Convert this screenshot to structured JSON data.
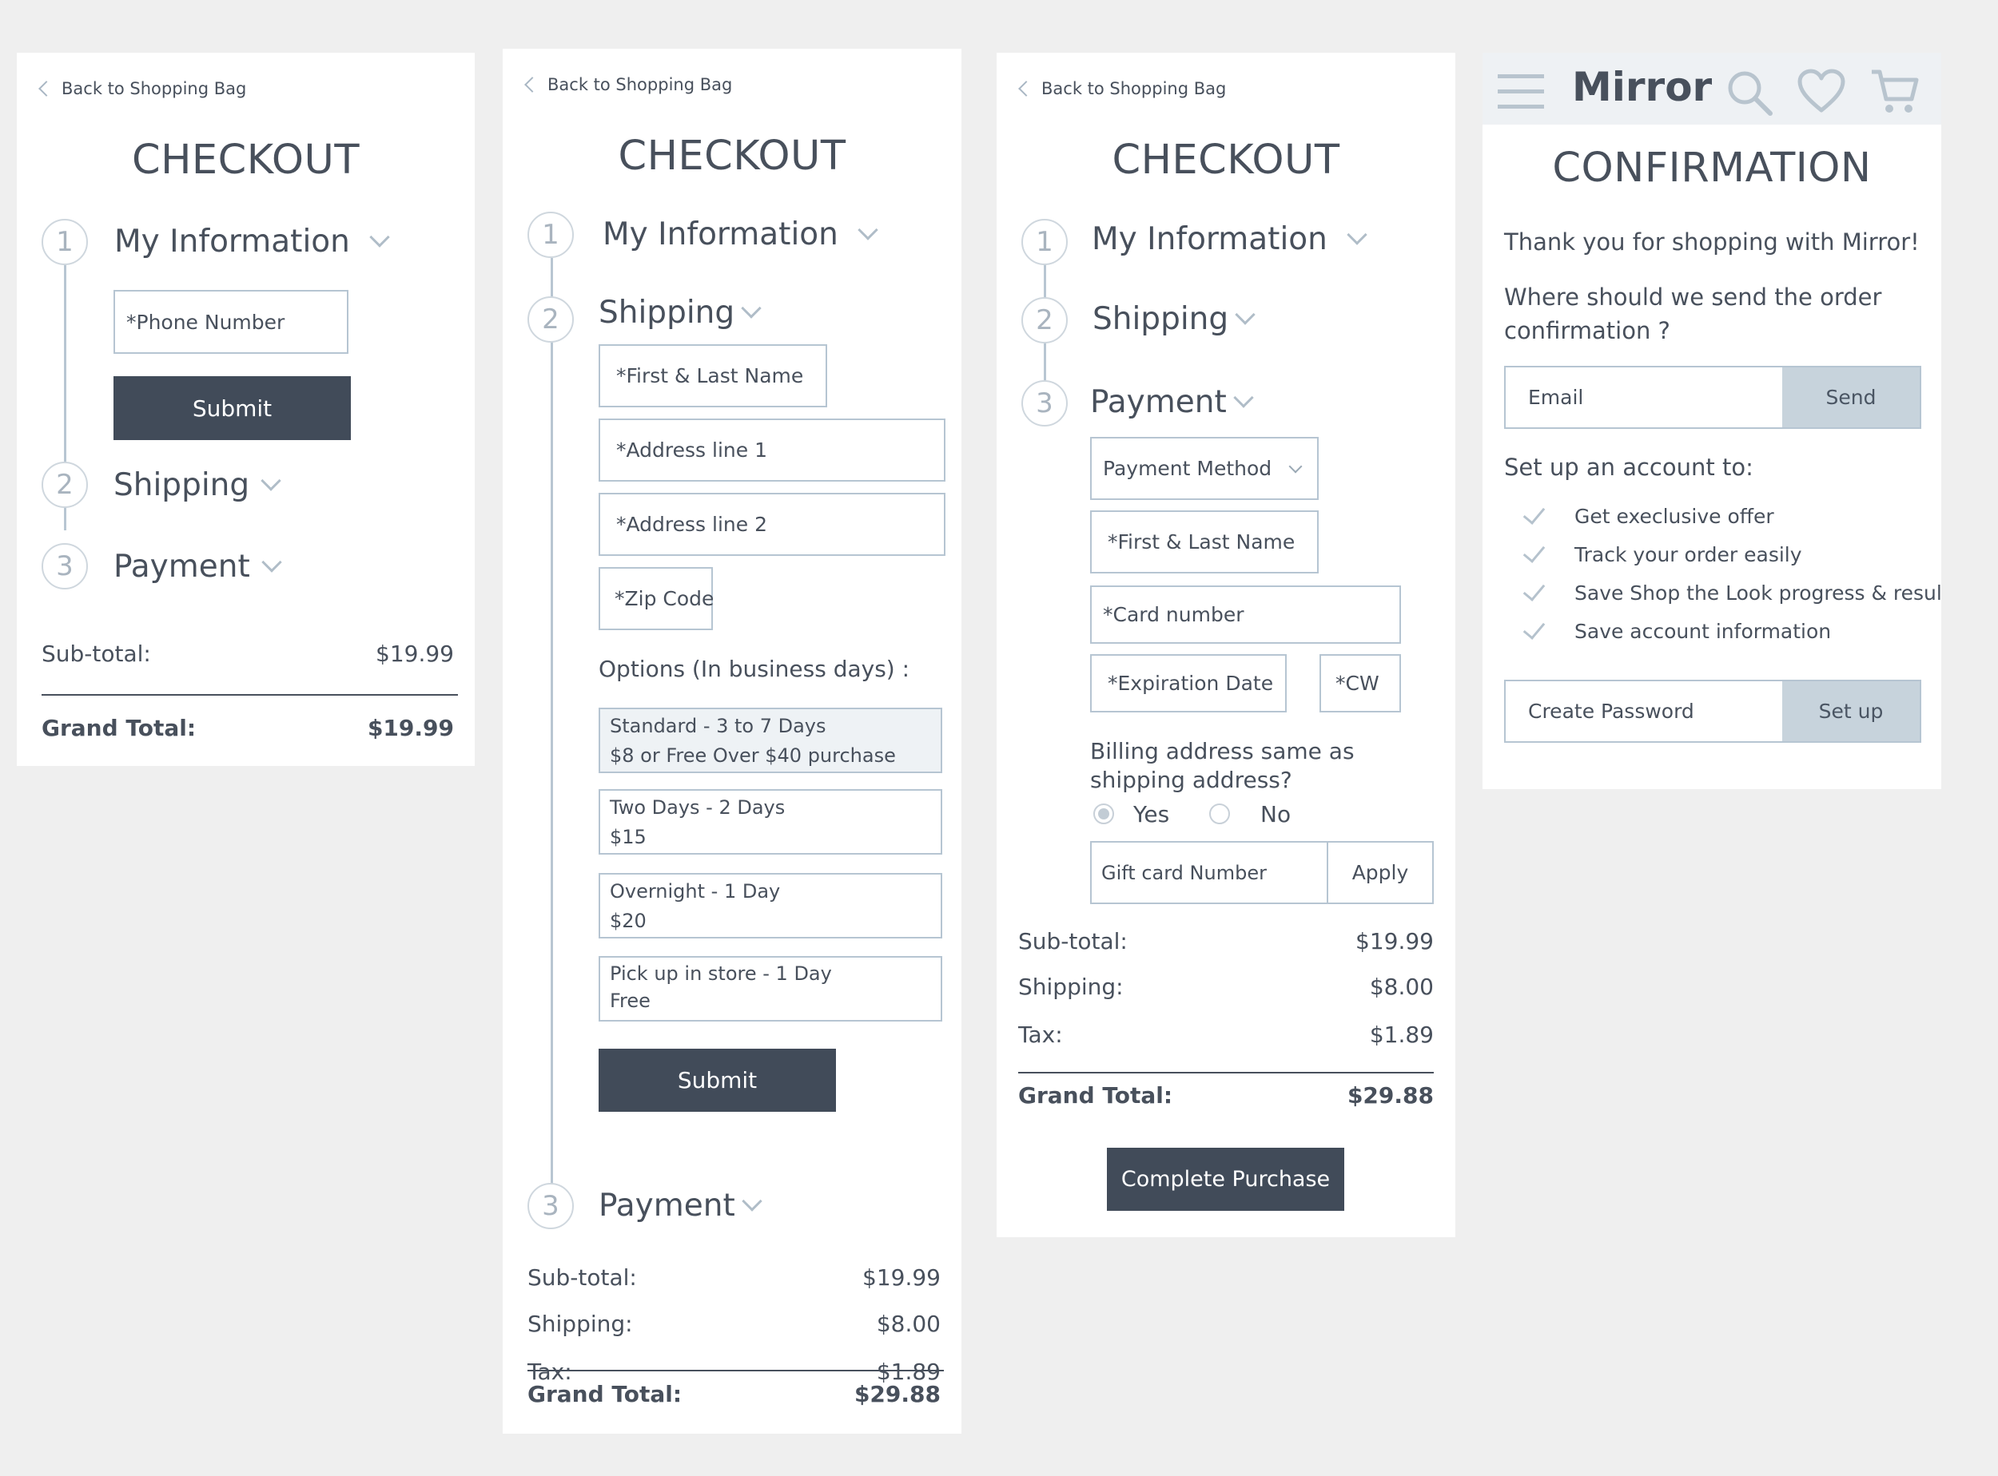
{
  "colors": {
    "accent_dark": "#414b59",
    "accent_light": "#c7d3dc",
    "border": "#b6c5d2",
    "background": "#efefef"
  },
  "panel1": {
    "back_label": "Back to Shopping Bag",
    "title": "CHECKOUT",
    "steps": [
      {
        "number": "1",
        "label": "My Information"
      },
      {
        "number": "2",
        "label": "Shipping"
      },
      {
        "number": "3",
        "label": "Payment"
      }
    ],
    "phone_placeholder": "*Phone Number",
    "submit_label": "Submit",
    "subtotal_label": "Sub-total:",
    "subtotal_value": "$19.99",
    "grand_label": "Grand Total:",
    "grand_value": "$19.99"
  },
  "panel2": {
    "back_label": "Back to Shopping Bag",
    "title": "CHECKOUT",
    "steps": [
      {
        "number": "1",
        "label": "My Information"
      },
      {
        "number": "2",
        "label": "Shipping"
      },
      {
        "number": "3",
        "label": "Payment"
      }
    ],
    "fields": {
      "name": "*First & Last Name",
      "address1": "*Address line 1",
      "address2": "*Address line 2",
      "zip": "*Zip Code"
    },
    "options_heading": "Options (In business days) :",
    "options": [
      {
        "line1": "Standard - 3 to 7 Days",
        "line2": "$8 or Free Over $40 purchase"
      },
      {
        "line1": "Two Days -  2 Days",
        "line2": "$15"
      },
      {
        "line1": "Overnight - 1 Day",
        "line2": "$20"
      },
      {
        "line1": "Pick up in store - 1 Day",
        "line2": "Free"
      }
    ],
    "submit_label": "Submit",
    "subtotal_label": "Sub-total:",
    "subtotal_value": "$19.99",
    "shipping_label": "Shipping:",
    "shipping_value": "$8.00",
    "tax_label": "Tax:",
    "tax_value": "$1.89",
    "grand_label": "Grand Total:",
    "grand_value": "$29.88"
  },
  "panel3": {
    "back_label": "Back to Shopping Bag",
    "title": "CHECKOUT",
    "steps": [
      {
        "number": "1",
        "label": "My Information"
      },
      {
        "number": "2",
        "label": "Shipping"
      },
      {
        "number": "3",
        "label": "Payment"
      }
    ],
    "payment_method": "Payment Method",
    "fields": {
      "name": "*First & Last Name",
      "card": "*Card number",
      "expiration": "*Expiration Date",
      "cvv": "*CW"
    },
    "billing_question": "Billing address same as shipping address?",
    "yes_label": "Yes",
    "no_label": "No",
    "gift_card_placeholder": "Gift card Number",
    "apply_label": "Apply",
    "subtotal_label": "Sub-total:",
    "subtotal_value": "$19.99",
    "shipping_label": "Shipping:",
    "shipping_value": "$8.00",
    "tax_label": "Tax:",
    "tax_value": "$1.89",
    "grand_label": "Grand Total:",
    "grand_value": "$29.88",
    "complete_label": "Complete Purchase"
  },
  "panel4": {
    "brand": "Mirror",
    "title": "CONFIRMATION",
    "thanks": "Thank you for shopping with Mirror!",
    "question": "Where should we send the order confirmation ?",
    "email_placeholder": "Email",
    "send_label": "Send",
    "account_heading": "Set up an account to:",
    "benefits": [
      "Get execlusive offer",
      "Track your order easily",
      "Save Shop the Look progress & result",
      "Save account information"
    ],
    "password_placeholder": "Create Password",
    "setup_label": "Set up",
    "icons": [
      "hamburger-menu-icon",
      "search-icon",
      "heart-icon",
      "cart-icon"
    ]
  }
}
